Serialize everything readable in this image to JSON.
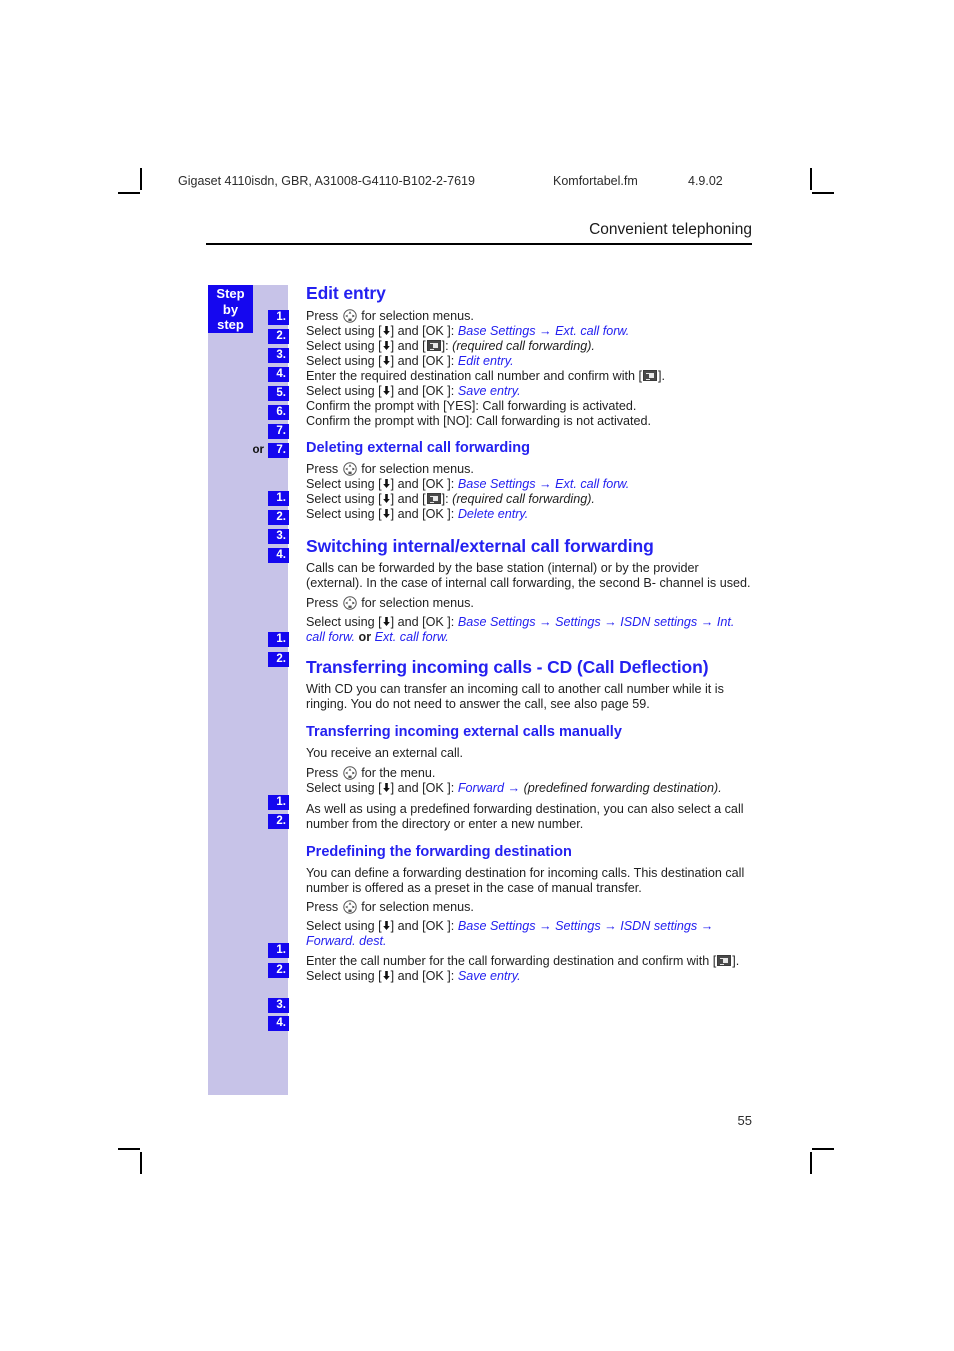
{
  "runhead": {
    "doc_id": "Gigaset 4110isdn, GBR, A31008-G4110-B102-2-7619",
    "fm_file": "Komfortabel.fm",
    "date": "4.9.02"
  },
  "chapter_title": "Convenient telephoning",
  "sidebar": {
    "badge_line1": "Step",
    "badge_line2": "by",
    "badge_line3": "step",
    "or_label": "or",
    "step_labels": [
      "1.",
      "2.",
      "3.",
      "4.",
      "5.",
      "6.",
      "7.",
      "7."
    ]
  },
  "icons": {
    "nav_key": "navigation-control-key-icon",
    "menu_key": "menu-display-key-icon",
    "down_key": "down-arrow-key-icon"
  },
  "sections": {
    "edit_entry": {
      "heading": "Edit entry",
      "steps": [
        {
          "num": "1.",
          "lead": "Press ",
          "mid": " for selection menus."
        },
        {
          "num": "2.",
          "lead": "Select using [",
          "mid": "] and [OK ]: ",
          "menu1": "Base Settings",
          "arrow": "→",
          "menu2": "Ext. call forw."
        },
        {
          "num": "3.",
          "lead": "Select using [",
          "mid": "] and [",
          "tail": "]: ",
          "italic": "(required call forwarding)."
        },
        {
          "num": "4.",
          "lead": "Select using [",
          "mid": "] and [OK ]: ",
          "menu1": "Edit entry."
        },
        {
          "num": "5.",
          "lead": "Enter the required destination call number and confirm with [",
          "tail": "]."
        },
        {
          "num": "6.",
          "lead": "Select using [",
          "mid": "] and [OK ]: ",
          "menu1": "Save entry."
        },
        {
          "num": "7.",
          "lead": "Confirm the prompt with [YES]: Call forwarding is activated."
        },
        {
          "num": "7.",
          "lead": "Confirm the prompt with [NO]: Call forwarding is not activated."
        }
      ]
    },
    "deleting": {
      "heading": "Deleting external call forwarding",
      "steps": [
        {
          "num": "1.",
          "lead": "Press ",
          "mid": " for selection menus."
        },
        {
          "num": "2.",
          "lead": "Select using [",
          "mid": "] and [OK ]: ",
          "menu1": "Base Settings",
          "arrow": "→",
          "menu2": "Ext. call forw."
        },
        {
          "num": "3.",
          "lead": "Select using [",
          "mid": "] and [",
          "tail": "]: ",
          "italic": "(required call forwarding)."
        },
        {
          "num": "4.",
          "lead": "Select using [",
          "mid": "] and [OK ]: ",
          "menu1": "Delete entry."
        }
      ]
    },
    "switching": {
      "heading": "Switching internal/external call forwarding",
      "body": "Calls can be forwarded by the base station (internal) or by the provider (external). In the case of internal call forwarding, the second B- channel is used.",
      "steps": [
        {
          "num": "1.",
          "lead": "Press ",
          "mid": " for selection menus."
        },
        {
          "num": "2.",
          "lead": "Select using [",
          "mid": "] and [OK ]: ",
          "menu1": "Base Settings",
          "arrow1": "→",
          "menu2": "Settings",
          "arrow2": "→",
          "menu3": "ISDN settings",
          "arrow3": "→",
          "menu4": "Int. call forw.",
          "conj": "or",
          "menu5": "Ext. call forw."
        }
      ]
    },
    "transferring": {
      "heading": "Transferring incoming calls - CD (Call Deflection)",
      "body": "With CD you can transfer an incoming call to another call number while it is ringing. You do not need to answer the call, see also page 59.",
      "sub_heading": "Transferring incoming external calls manually",
      "sub_body": "You receive an external call.",
      "steps": [
        {
          "num": "1.",
          "lead": "Press ",
          "mid": " for the menu."
        },
        {
          "num": "2.",
          "lead": "Select using [",
          "mid": "] and [OK ]: ",
          "menu1": "Forward",
          "arrow": "→",
          "italic": "(predefined forwarding destination)."
        }
      ],
      "after_body": "As well as using a predefined forwarding destination, you can also select a call number from the directory or enter a new number."
    },
    "predefining": {
      "heading": "Predefining the forwarding destination",
      "body": "You can define a forwarding destination for incoming calls. This destination call number is offered as a preset in the case of manual transfer.",
      "steps": [
        {
          "num": "1.",
          "lead": "Press ",
          "mid": " for selection menus."
        },
        {
          "num": "2.",
          "lead": "Select using [",
          "mid": "] and [OK ]: ",
          "menu1": "Base Settings",
          "arrow1": "→",
          "menu2": "Settings",
          "arrow2": "→",
          "menu3": "ISDN settings",
          "arrow3": "→",
          "menu4": "Forward. dest."
        },
        {
          "num": "3.",
          "lead": "Enter the call number for the call forwarding destination and confirm with [",
          "tail": "]."
        },
        {
          "num": "4.",
          "lead": "Select using [",
          "mid": "] and [OK ]: ",
          "menu1": "Save entry."
        }
      ]
    }
  },
  "page_number": "55",
  "colors": {
    "accent_blue": "#2421f0",
    "badge_blue": "#1507ef",
    "sidebar_lilac": "#c7c3e8"
  }
}
